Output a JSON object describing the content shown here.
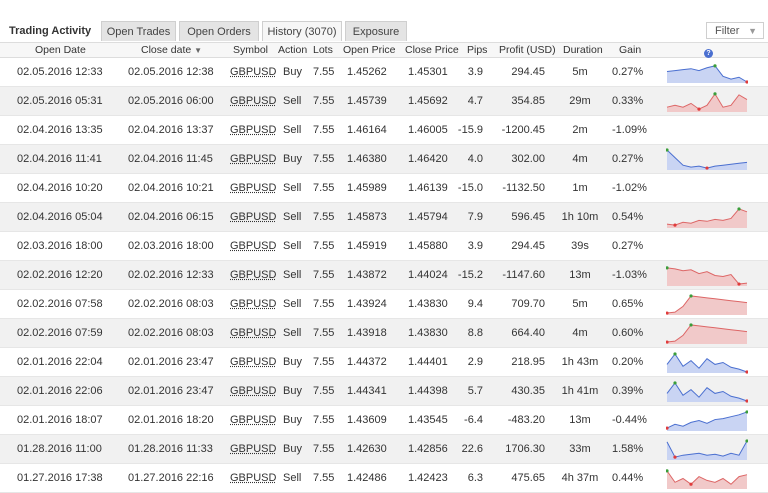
{
  "panel": {
    "title": "Trading Activity",
    "tabs": [
      {
        "label": "Open Trades",
        "active": false
      },
      {
        "label": "Open Orders",
        "active": false
      },
      {
        "label": "History (3070)",
        "active": true
      },
      {
        "label": "Exposure",
        "active": false
      }
    ],
    "filter_label": "Filter",
    "filter_icon": "chevron-down-icon"
  },
  "columns": {
    "open_date": "Open Date",
    "close_date": "Close date",
    "close_date_sort_icon": "sort-desc-icon",
    "symbol": "Symbol",
    "action": "Action",
    "lots": "Lots",
    "open_price": "Open Price",
    "close_price": "Close Price",
    "pips": "Pips",
    "profit": "Profit (USD)",
    "duration": "Duration",
    "gain": "Gain",
    "chart_icon": "info-icon"
  },
  "colors": {
    "positive": "#3a9d3a",
    "negative": "#e03b3b",
    "buy_chart": "#4a6fd0",
    "sell_chart": "#d66"
  },
  "rows": [
    {
      "open": "02.05.2016 12:33",
      "close": "02.05.2016 12:38",
      "symbol": "GBPUSD",
      "action": "Buy",
      "lots": "7.55",
      "open_price": "1.45262",
      "close_price": "1.45301",
      "pips": "3.9",
      "profit": "294.45",
      "duration": "5m",
      "gain": "0.27%",
      "spark": [
        0.55,
        0.6,
        0.65,
        0.7,
        0.6,
        0.75,
        0.85,
        0.3,
        0.15,
        0.25,
        0.0
      ]
    },
    {
      "open": "02.05.2016 05:31",
      "close": "02.05.2016 06:00",
      "symbol": "GBPUSD",
      "action": "Sell",
      "lots": "7.55",
      "open_price": "1.45739",
      "close_price": "1.45692",
      "pips": "4.7",
      "profit": "354.85",
      "duration": "29m",
      "gain": "0.33%",
      "spark": [
        0.2,
        0.3,
        0.2,
        0.4,
        0.1,
        0.3,
        0.9,
        0.2,
        0.3,
        0.85,
        0.6
      ]
    },
    {
      "open": "02.04.2016 13:35",
      "close": "02.04.2016 13:37",
      "symbol": "GBPUSD",
      "action": "Sell",
      "lots": "7.55",
      "open_price": "1.46164",
      "close_price": "1.46005",
      "pips": "-15.9",
      "profit": "-1200.45",
      "duration": "2m",
      "gain": "-1.09%",
      "spark": []
    },
    {
      "open": "02.04.2016 11:41",
      "close": "02.04.2016 11:45",
      "symbol": "GBPUSD",
      "action": "Buy",
      "lots": "7.55",
      "open_price": "1.46380",
      "close_price": "1.46420",
      "pips": "4.0",
      "profit": "302.00",
      "duration": "4m",
      "gain": "0.27%",
      "spark": [
        1.0,
        0.6,
        0.2,
        0.1,
        0.15,
        0.05,
        0.15,
        0.2,
        0.25,
        0.3,
        0.35
      ]
    },
    {
      "open": "02.04.2016 10:20",
      "close": "02.04.2016 10:21",
      "symbol": "GBPUSD",
      "action": "Sell",
      "lots": "7.55",
      "open_price": "1.45989",
      "close_price": "1.46139",
      "pips": "-15.0",
      "profit": "-1132.50",
      "duration": "1m",
      "gain": "-1.02%",
      "spark": []
    },
    {
      "open": "02.04.2016 05:04",
      "close": "02.04.2016 06:15",
      "symbol": "GBPUSD",
      "action": "Sell",
      "lots": "7.55",
      "open_price": "1.45873",
      "close_price": "1.45794",
      "pips": "7.9",
      "profit": "596.45",
      "duration": "1h 10m",
      "gain": "0.54%",
      "spark": [
        0.15,
        0.1,
        0.25,
        0.2,
        0.35,
        0.3,
        0.4,
        0.35,
        0.45,
        0.95,
        0.8
      ]
    },
    {
      "open": "02.03.2016 18:00",
      "close": "02.03.2016 18:00",
      "symbol": "GBPUSD",
      "action": "Sell",
      "lots": "7.55",
      "open_price": "1.45919",
      "close_price": "1.45880",
      "pips": "3.9",
      "profit": "294.45",
      "duration": "39s",
      "gain": "0.27%",
      "spark": []
    },
    {
      "open": "02.02.2016 12:20",
      "close": "02.02.2016 12:33",
      "symbol": "GBPUSD",
      "action": "Sell",
      "lots": "7.55",
      "open_price": "1.43872",
      "close_price": "1.44024",
      "pips": "-15.2",
      "profit": "-1147.60",
      "duration": "13m",
      "gain": "-1.03%",
      "spark": [
        0.9,
        0.85,
        0.75,
        0.8,
        0.6,
        0.7,
        0.5,
        0.45,
        0.55,
        0.05,
        0.1
      ]
    },
    {
      "open": "02.02.2016 07:58",
      "close": "02.02.2016 08:03",
      "symbol": "GBPUSD",
      "action": "Sell",
      "lots": "7.55",
      "open_price": "1.43924",
      "close_price": "1.43830",
      "pips": "9.4",
      "profit": "709.70",
      "duration": "5m",
      "gain": "0.65%",
      "spark": [
        0.05,
        0.1,
        0.4,
        0.95,
        0.9,
        0.85,
        0.8,
        0.75,
        0.7,
        0.65,
        0.6
      ]
    },
    {
      "open": "02.02.2016 07:59",
      "close": "02.02.2016 08:03",
      "symbol": "GBPUSD",
      "action": "Sell",
      "lots": "7.55",
      "open_price": "1.43918",
      "close_price": "1.43830",
      "pips": "8.8",
      "profit": "664.40",
      "duration": "4m",
      "gain": "0.60%",
      "spark": [
        0.05,
        0.1,
        0.4,
        0.95,
        0.9,
        0.85,
        0.8,
        0.75,
        0.7,
        0.65,
        0.6
      ]
    },
    {
      "open": "02.01.2016 22:04",
      "close": "02.01.2016 23:47",
      "symbol": "GBPUSD",
      "action": "Buy",
      "lots": "7.55",
      "open_price": "1.44372",
      "close_price": "1.44401",
      "pips": "2.9",
      "profit": "218.95",
      "duration": "1h 43m",
      "gain": "0.20%",
      "spark": [
        0.4,
        0.95,
        0.3,
        0.6,
        0.2,
        0.7,
        0.4,
        0.5,
        0.25,
        0.15,
        0.0
      ]
    },
    {
      "open": "02.01.2016 22:06",
      "close": "02.01.2016 23:47",
      "symbol": "GBPUSD",
      "action": "Buy",
      "lots": "7.55",
      "open_price": "1.44341",
      "close_price": "1.44398",
      "pips": "5.7",
      "profit": "430.35",
      "duration": "1h 41m",
      "gain": "0.39%",
      "spark": [
        0.4,
        0.95,
        0.3,
        0.6,
        0.2,
        0.7,
        0.4,
        0.5,
        0.25,
        0.15,
        0.0
      ]
    },
    {
      "open": "02.01.2016 18:07",
      "close": "02.01.2016 18:20",
      "symbol": "GBPUSD",
      "action": "Buy",
      "lots": "7.55",
      "open_price": "1.43609",
      "close_price": "1.43545",
      "pips": "-6.4",
      "profit": "-483.20",
      "duration": "13m",
      "gain": "-0.44%",
      "spark": [
        0.1,
        0.3,
        0.2,
        0.4,
        0.5,
        0.35,
        0.55,
        0.6,
        0.7,
        0.8,
        0.95
      ]
    },
    {
      "open": "01.28.2016 11:00",
      "close": "01.28.2016 11:33",
      "symbol": "GBPUSD",
      "action": "Buy",
      "lots": "7.55",
      "open_price": "1.42630",
      "close_price": "1.42856",
      "pips": "22.6",
      "profit": "1706.30",
      "duration": "33m",
      "gain": "1.58%",
      "spark": [
        0.9,
        0.1,
        0.2,
        0.25,
        0.3,
        0.2,
        0.25,
        0.15,
        0.3,
        0.2,
        0.95
      ]
    },
    {
      "open": "01.27.2016 17:38",
      "close": "01.27.2016 22:16",
      "symbol": "GBPUSD",
      "action": "Sell",
      "lots": "7.55",
      "open_price": "1.42486",
      "close_price": "1.42423",
      "pips": "6.3",
      "profit": "475.65",
      "duration": "4h 37m",
      "gain": "0.44%",
      "spark": [
        0.9,
        0.3,
        0.5,
        0.2,
        0.6,
        0.4,
        0.3,
        0.5,
        0.2,
        0.6,
        0.7
      ]
    }
  ]
}
